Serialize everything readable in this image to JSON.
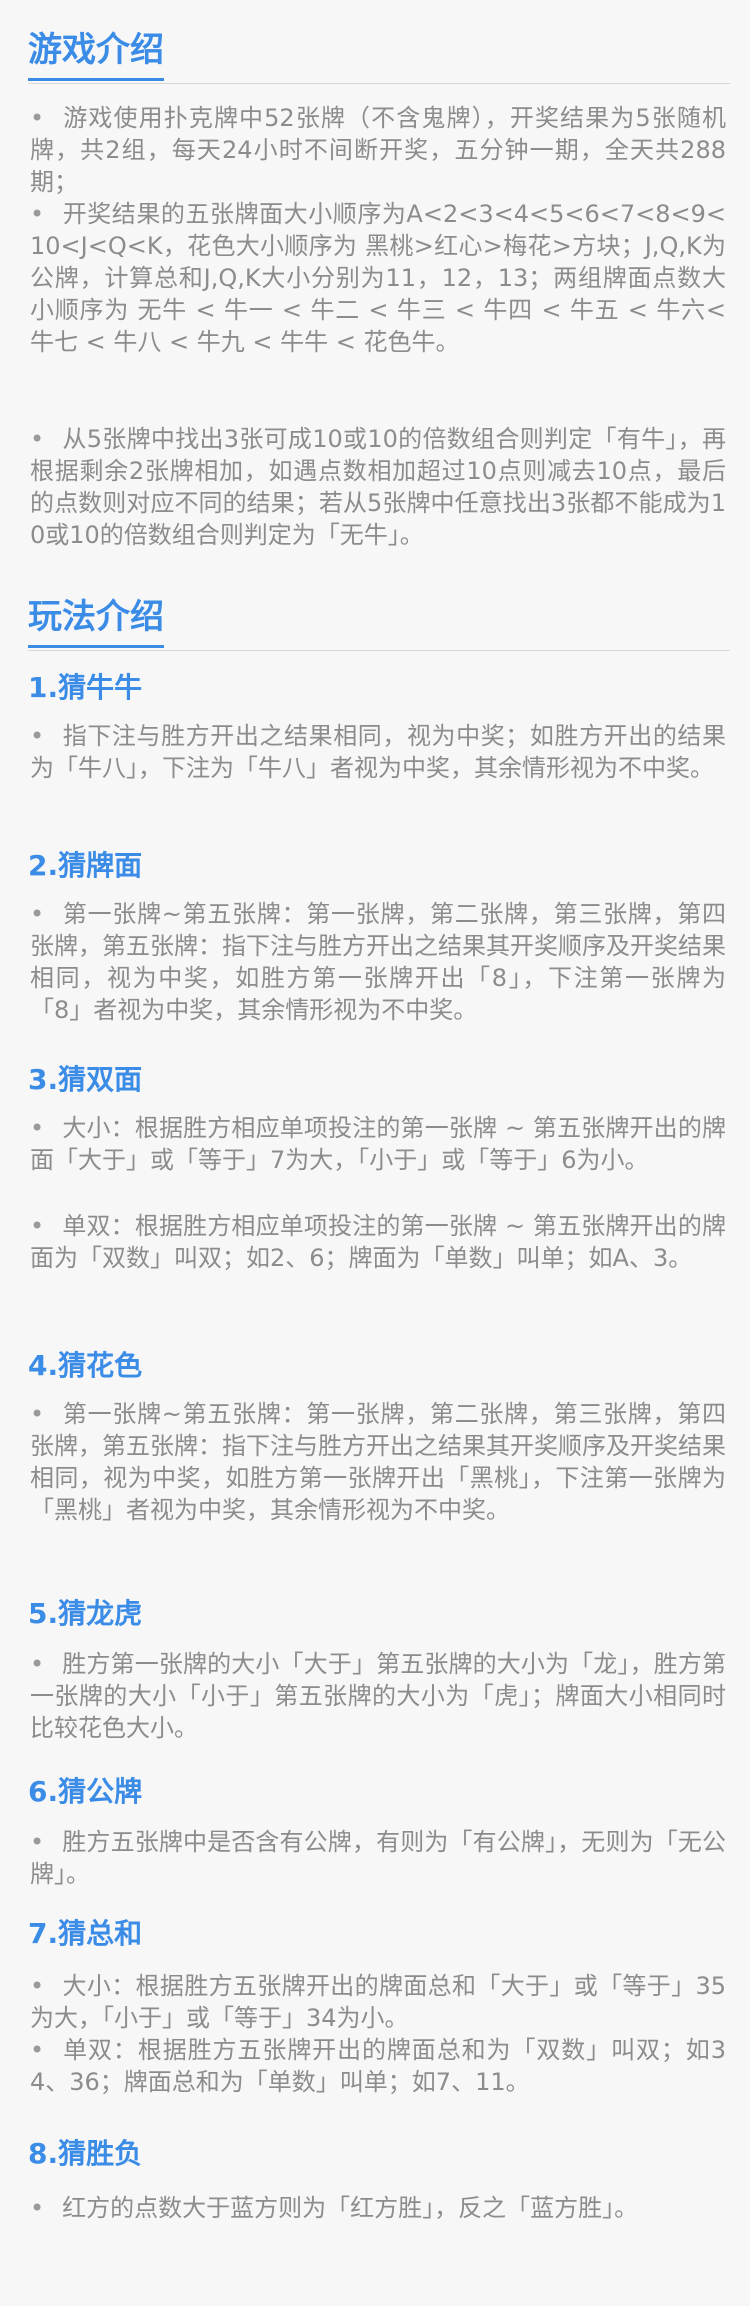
{
  "game_intro": {
    "title": "游戏介绍",
    "bullets": [
      "游戏使用扑克牌中52张牌（不含鬼牌），开奖结果为5张随机牌，共2组，每天24小时不间断开奖，五分钟一期，全天共288期；",
      "开奖结果的五张牌面大小顺序为A<2<3<4<5<6<7<8<9<10<J<Q<K，花色大小顺序为 黑桃>红心>梅花>方块；J,Q,K为公牌，计算总和J,Q,K大小分别为11，12，13；两组牌面点数大小顺序为 无牛 < 牛一 < 牛二 < 牛三 < 牛四 < 牛五 < 牛六< 牛七 < 牛八 < 牛九 < 牛牛 < 花色牛。",
      "从5张牌中找出3张可成10或10的倍数组合则判定「有牛」，再根据剩余2张牌相加，如遇点数相加超过10点则减去10点，最后的点数则对应不同的结果；若从5张牌中任意找出3张都不能成为10或10的倍数组合则判定为「无牛」。"
    ]
  },
  "play_intro": {
    "title": "玩法介绍",
    "sections": [
      {
        "heading": "1.猜牛牛",
        "bullets": [
          "指下注与胜方开出之结果相同，视为中奖；如胜方开出的结果为「牛八」，下注为「牛八」者视为中奖，其余情形视为不中奖。"
        ]
      },
      {
        "heading": "2.猜牌面",
        "bullets": [
          "第一张牌~第五张牌：第一张牌，第二张牌，第三张牌，第四张牌，第五张牌：指下注与胜方开出之结果其开奖顺序及开奖结果相同，视为中奖，如胜方第一张牌开出「8」，下注第一张牌为「8」者视为中奖，其余情形视为不中奖。"
        ]
      },
      {
        "heading": "3.猜双面",
        "bullets": [
          "大小：根据胜方相应单项投注的第一张牌 ~ 第五张牌开出的牌面「大于」或「等于」7为大，「小于」或「等于」6为小。",
          "单双：根据胜方相应单项投注的第一张牌 ~ 第五张牌开出的牌面为「双数」叫双；如2、6；牌面为「单数」叫单；如A、3。"
        ]
      },
      {
        "heading": "4.猜花色",
        "bullets": [
          "第一张牌~第五张牌：第一张牌，第二张牌，第三张牌，第四张牌，第五张牌：指下注与胜方开出之结果其开奖顺序及开奖结果相同，视为中奖，如胜方第一张牌开出「黑桃」，下注第一张牌为「黑桃」者视为中奖，其余情形视为不中奖。"
        ]
      },
      {
        "heading": "5.猜龙虎",
        "bullets": [
          "胜方第一张牌的大小「大于」第五张牌的大小为「龙」，胜方第一张牌的大小「小于」第五张牌的大小为「虎」；牌面大小相同时比较花色大小。"
        ]
      },
      {
        "heading": "6.猜公牌",
        "bullets": [
          "胜方五张牌中是否含有公牌，有则为「有公牌」，无则为「无公牌」。"
        ]
      },
      {
        "heading": "7.猜总和",
        "bullets": [
          "大小：根据胜方五张牌开出的牌面总和「大于」或「等于」35为大，「小于」或「等于」34为小。",
          "单双：根据胜方五张牌开出的牌面总和为「双数」叫双；如34、36；牌面总和为「单数」叫单；如7、11。"
        ]
      },
      {
        "heading": "8.猜胜负",
        "bullets": [
          "红方的点数大于蓝方则为「红方胜」，反之「蓝方胜」。"
        ]
      }
    ]
  },
  "bullet_char": "•",
  "colors": {
    "accent": "#3b8ce6",
    "text": "#8c8c8c",
    "background": "#f7f7f8"
  }
}
